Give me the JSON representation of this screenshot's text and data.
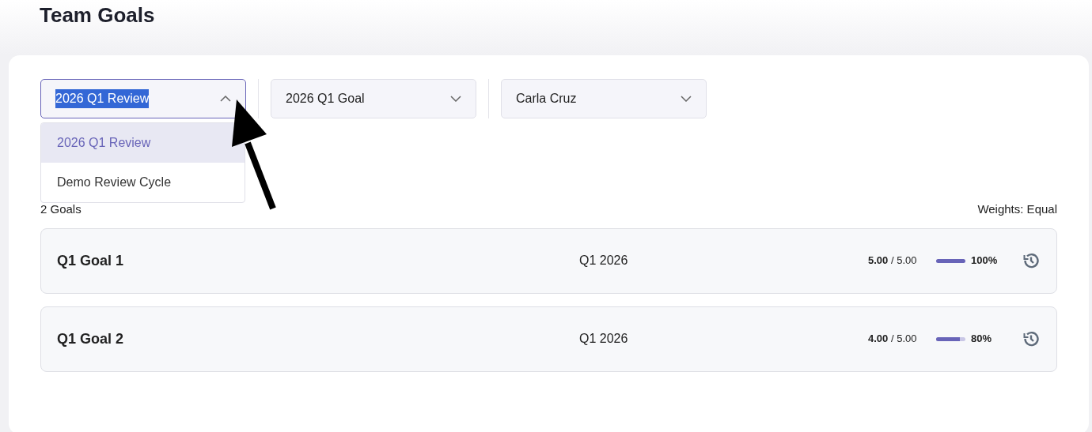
{
  "page": {
    "title": "Team Goals"
  },
  "filters": [
    {
      "value": "2026 Q1 Review",
      "open": true,
      "text_selected": true
    },
    {
      "value": "2026 Q1 Goal",
      "open": false,
      "text_selected": false
    },
    {
      "value": "Carla Cruz",
      "open": false,
      "text_selected": false
    }
  ],
  "dropdown_options": [
    {
      "label": "2026 Q1 Review",
      "selected": true
    },
    {
      "label": "Demo Review Cycle",
      "selected": false
    }
  ],
  "summary": {
    "count": "2 Goals",
    "weights": "Weights: Equal"
  },
  "goals": [
    {
      "title": "Q1 Goal 1",
      "period": "Q1 2026",
      "score": "**5.00** / 5.00",
      "level": 1.0,
      "percent": "100%"
    },
    {
      "title": "Q1 Goal 2",
      "period": "Q1 2026",
      "score": "**4.00** / 5.00",
      "level": 0.8,
      "percent": "80%"
    }
  ]
}
